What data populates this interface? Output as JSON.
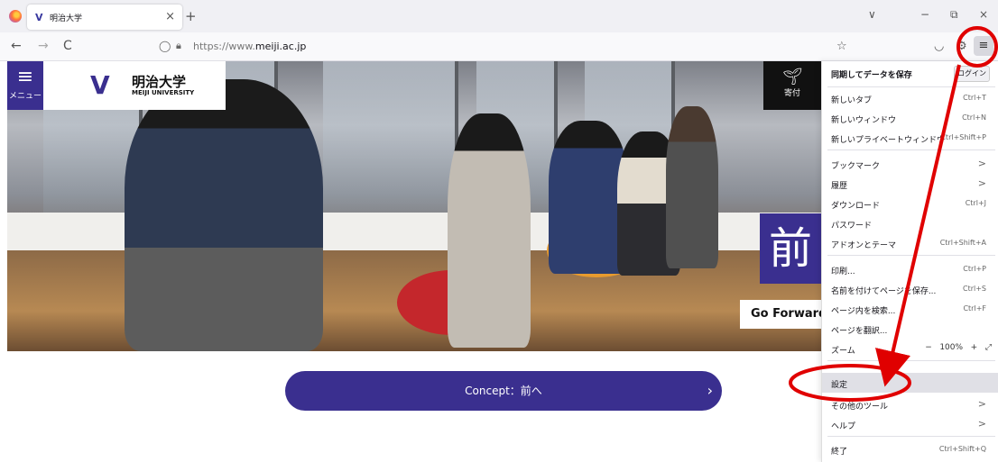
{
  "browser": {
    "tab_title": "明治大学",
    "tab_close": "×",
    "new_tab": "+",
    "url_prefix": "https://www.",
    "url_domain": "meiji.ac.jp",
    "nav_back": "←",
    "nav_forward": "→",
    "nav_reload": "C",
    "window_controls": [
      "∨",
      "−",
      "⧉",
      "×"
    ]
  },
  "site": {
    "menu_label": "メニュー",
    "logo_jp": "明治大学",
    "logo_en": "MEIJI UNIVERSITY",
    "donate_label": "寄付",
    "hero_kanji": "前",
    "hero_tagline": "Go Forward,",
    "concept_button": "Concept：前へ",
    "concept_arrow": "›"
  },
  "app_menu": {
    "sync_label": "同期してデータを保存",
    "login_label": "ログイン",
    "items": [
      {
        "label": "新しいタブ",
        "shortcut": "Ctrl+T"
      },
      {
        "label": "新しいウィンドウ",
        "shortcut": "Ctrl+N"
      },
      {
        "label": "新しいプライベートウィンドウ",
        "shortcut": "Ctrl+Shift+P"
      },
      {
        "label": "ブックマーク",
        "shortcut": ">"
      },
      {
        "label": "履歴",
        "shortcut": ">"
      },
      {
        "label": "ダウンロード",
        "shortcut": "Ctrl+J"
      },
      {
        "label": "パスワード",
        "shortcut": ""
      },
      {
        "label": "アドオンとテーマ",
        "shortcut": "Ctrl+Shift+A"
      },
      {
        "label": "印刷...",
        "shortcut": "Ctrl+P"
      },
      {
        "label": "名前を付けてページを保存...",
        "shortcut": "Ctrl+S"
      },
      {
        "label": "ページ内を検索...",
        "shortcut": "Ctrl+F"
      },
      {
        "label": "ページを翻訳...",
        "shortcut": ""
      },
      {
        "label": "ズーム",
        "shortcut": ""
      },
      {
        "label": "設定",
        "shortcut": ""
      },
      {
        "label": "その他のツール",
        "shortcut": ">"
      },
      {
        "label": "ヘルプ",
        "shortcut": ">"
      },
      {
        "label": "終了",
        "shortcut": "Ctrl+Shift+Q"
      }
    ],
    "zoom_value": "100%",
    "zoom_minus": "−",
    "zoom_plus": "+",
    "zoom_full": "⤢"
  },
  "colors": {
    "brand": "#3a2f8f",
    "annotation": "#e00000"
  }
}
